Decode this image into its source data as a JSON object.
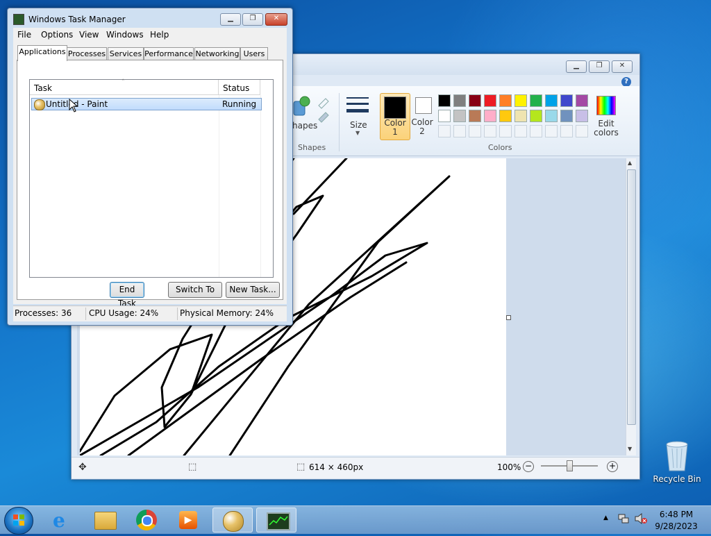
{
  "taskmanager": {
    "title": "Windows Task Manager",
    "menu": [
      "File",
      "Options",
      "View",
      "Windows",
      "Help"
    ],
    "tabs": [
      "Applications",
      "Processes",
      "Services",
      "Performance",
      "Networking",
      "Users"
    ],
    "columns": {
      "task": "Task",
      "status": "Status"
    },
    "rows": [
      {
        "task": "Untitled - Paint",
        "status": "Running"
      }
    ],
    "buttons": {
      "end_task": "End Task",
      "switch_to": "Switch To",
      "new_task": "New Task..."
    },
    "status": {
      "processes": "Processes: 36",
      "cpu": "CPU Usage: 24%",
      "memory": "Physical Memory: 24%"
    }
  },
  "paint": {
    "ribbon": {
      "shapes_label": "hapes",
      "shapes_group": "Shapes",
      "size_label": "Size",
      "color1_label": "Color\n1",
      "color2_label": "Color\n2",
      "colors_group": "Colors",
      "edit_colors_label": "Edit\ncolors",
      "palette_row1": [
        "#000000",
        "#7f7f7f",
        "#880015",
        "#ed1c24",
        "#ff7f27",
        "#fff200",
        "#22b14c",
        "#00a2e8",
        "#3f48cc",
        "#a349a4"
      ],
      "palette_row2": [
        "#ffffff",
        "#c3c3c3",
        "#b97a57",
        "#ffaec9",
        "#ffc90e",
        "#efe4b0",
        "#b5e61d",
        "#99d9ea",
        "#7092be",
        "#c8bfe7"
      ]
    },
    "status": {
      "dimensions": "614 × 460px",
      "zoom": "100%"
    }
  },
  "desktop": {
    "recycle_bin": "Recycle Bin"
  },
  "taskbar": {
    "time": "6:48 PM",
    "date": "9/28/2023"
  }
}
